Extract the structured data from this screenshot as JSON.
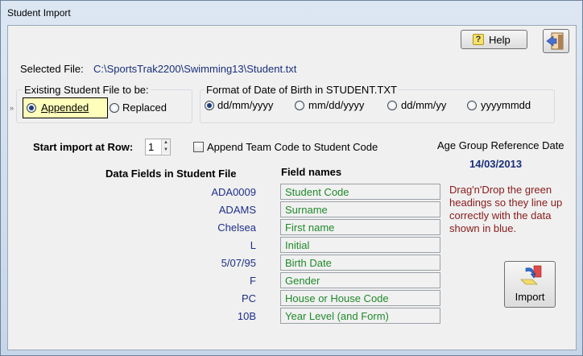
{
  "window": {
    "title": "Student Import"
  },
  "toolbar": {
    "help_label": "Help",
    "help_icon": "help-book-icon",
    "exit_icon": "exit-door-icon",
    "import_label": "Import",
    "import_icon": "import-arrow-icon"
  },
  "selected_file": {
    "label": "Selected File:",
    "path": "C:\\SportsTrak2200\\Swimming13\\Student.txt"
  },
  "existing_file": {
    "label": "Existing Student File to be:",
    "options": [
      "Appended",
      "Replaced"
    ],
    "selected": "Appended"
  },
  "dob_format": {
    "label": "Format of Date of Birth in STUDENT.TXT",
    "options": [
      "dd/mm/yyyy",
      "mm/dd/yyyy",
      "dd/mm/yy",
      "yyyymmdd"
    ],
    "selected": "dd/mm/yyyy"
  },
  "start_row": {
    "label": "Start import at Row:",
    "value": "1"
  },
  "append_team": {
    "label": "Append Team Code to Student Code",
    "checked": false
  },
  "age_group": {
    "label": "Age Group Reference Date",
    "date": "14/03/2013"
  },
  "columns": {
    "data_header": "Data Fields in Student File",
    "field_header": "Field names"
  },
  "rows": [
    {
      "data": "ADA0009",
      "field": "Student Code"
    },
    {
      "data": "ADAMS",
      "field": "Surname"
    },
    {
      "data": "Chelsea",
      "field": "First name"
    },
    {
      "data": "L",
      "field": "Initial"
    },
    {
      "data": "5/07/95",
      "field": "Birth Date"
    },
    {
      "data": "F",
      "field": "Gender"
    },
    {
      "data": "PC",
      "field": "House or House Code"
    },
    {
      "data": "10B",
      "field": "Year Level (and Form)"
    }
  ],
  "instructions": "Drag'n'Drop the green headings so they line up correctly with the data shown in blue.",
  "colors": {
    "data_text": "#1f2f8a",
    "field_text": "#1f8a2a",
    "instruction_text": "#8a1a1a",
    "highlight": "#ffffbb"
  }
}
